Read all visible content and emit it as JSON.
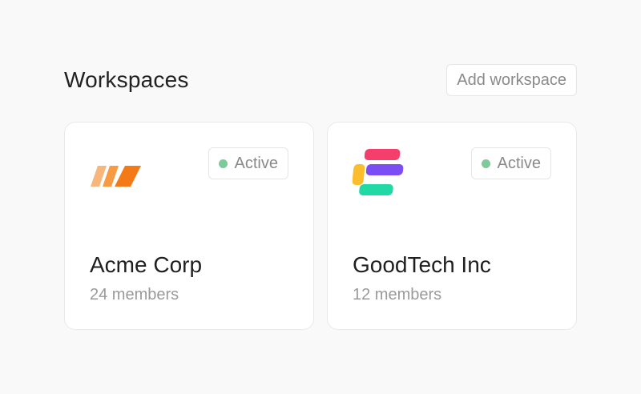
{
  "header": {
    "title": "Workspaces",
    "add_button_label": "Add workspace"
  },
  "workspaces": [
    {
      "name": "Acme Corp",
      "members": "24 members",
      "status": "Active",
      "logo_icon": "acme-stripes-logo-icon",
      "logo_colors": [
        "#f7b77c",
        "#f89a42",
        "#f47a18"
      ]
    },
    {
      "name": "GoodTech Inc",
      "members": "12 members",
      "status": "Active",
      "logo_icon": "goodtech-s-logo-icon",
      "logo_colors": [
        "#f43e6c",
        "#fbbd2c",
        "#7b4ef5",
        "#21d9a5"
      ]
    }
  ],
  "colors": {
    "background": "#f9f9f9",
    "card_background": "#ffffff",
    "border": "#e6e6e6",
    "status_active": "#7ccb98",
    "muted_text": "#8a8a8a"
  }
}
